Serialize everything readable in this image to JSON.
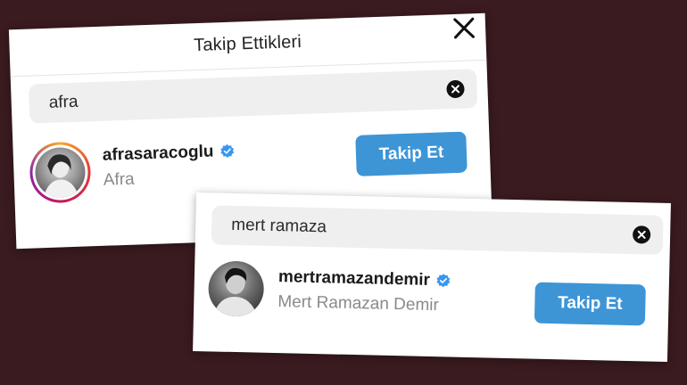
{
  "panel1": {
    "title": "Takip Ettikleri",
    "close_icon": "close-icon",
    "search": {
      "value": "afra"
    },
    "result": {
      "username": "afrasaracoglu",
      "full_name": "Afra",
      "verified": true,
      "has_story_ring": true,
      "follow_label": "Takip Et"
    }
  },
  "panel2": {
    "search": {
      "value": "mert ramaza"
    },
    "result": {
      "username": "mertramazandemir",
      "full_name": "Mert Ramazan Demir",
      "verified": true,
      "has_story_ring": false,
      "follow_label": "Takip Et"
    }
  },
  "colors": {
    "background": "#3a1b1f",
    "follow_button": "#3d95d6",
    "verified_badge": "#3897f0",
    "search_bg": "#efefef"
  }
}
